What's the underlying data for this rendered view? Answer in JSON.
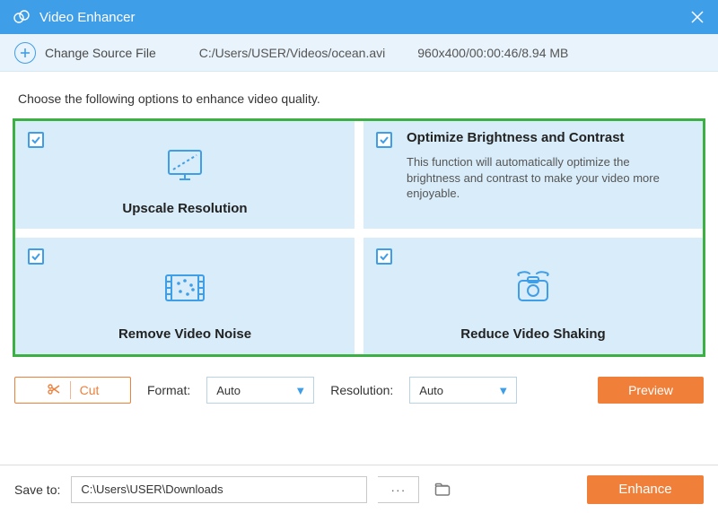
{
  "titlebar": {
    "title": "Video Enhancer"
  },
  "sourcebar": {
    "change_label": "Change Source File",
    "file_path": "C:/Users/USER/Videos/ocean.avi",
    "file_meta": "960x400/00:00:46/8.94 MB"
  },
  "instruction": "Choose the following options to enhance video quality.",
  "cards": {
    "upscale": {
      "title": "Upscale Resolution",
      "checked": true
    },
    "optimize": {
      "title": "Optimize Brightness and Contrast",
      "desc": "This function will automatically optimize the brightness and contrast to make your video more enjoyable.",
      "checked": true
    },
    "noise": {
      "title": "Remove Video Noise",
      "checked": true
    },
    "shaking": {
      "title": "Reduce Video Shaking",
      "checked": true
    }
  },
  "controls": {
    "cut_label": "Cut",
    "format_label": "Format:",
    "format_value": "Auto",
    "resolution_label": "Resolution:",
    "resolution_value": "Auto",
    "preview_label": "Preview"
  },
  "bottom": {
    "saveto_label": "Save to:",
    "save_path": "C:\\Users\\USER\\Downloads",
    "browse_label": "···",
    "enhance_label": "Enhance"
  }
}
